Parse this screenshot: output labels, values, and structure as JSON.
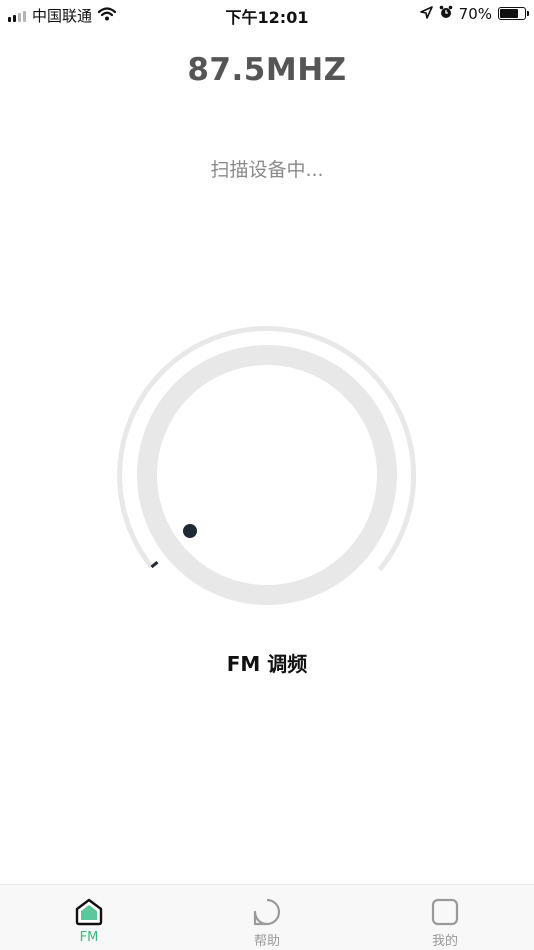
{
  "status_bar": {
    "carrier": "中国联通",
    "time": "下午12:01",
    "battery_percent": "70%",
    "battery_level": 0.7,
    "icons": [
      "signal-icon",
      "wifi-icon",
      "location-icon",
      "alarm-icon",
      "battery-icon"
    ]
  },
  "frequency": {
    "value": "87.5MHZ"
  },
  "scan": {
    "status": "扫描设备中..."
  },
  "dial": {
    "label": "FM 调频"
  },
  "tabs": [
    {
      "label": "FM",
      "icon": "home-icon",
      "active": true
    },
    {
      "label": "帮助",
      "icon": "help-icon",
      "active": false
    },
    {
      "label": "我的",
      "icon": "profile-icon",
      "active": false
    }
  ],
  "colors": {
    "accent": "#3cb87a",
    "dial_track": "#e8e8e8",
    "knob_dot": "#1e2a36",
    "tab_inactive": "#999999"
  }
}
